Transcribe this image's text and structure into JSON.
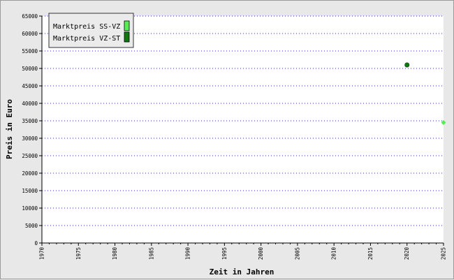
{
  "chart_data": {
    "type": "scatter",
    "xlabel": "Zeit in Jahren",
    "ylabel": "Preis in Euro",
    "xlim": [
      1970,
      2025
    ],
    "ylim": [
      0,
      65000
    ],
    "x_ticks": [
      1970,
      1975,
      1980,
      1985,
      1990,
      1995,
      2000,
      2005,
      2010,
      2015,
      2020,
      2025
    ],
    "y_ticks": [
      0,
      5000,
      10000,
      15000,
      20000,
      25000,
      30000,
      35000,
      40000,
      45000,
      50000,
      55000,
      60000,
      65000
    ],
    "grid": "horizontal-dotted",
    "legend_position": "top-left",
    "series": [
      {
        "name": "Marktpreis SS-VZ",
        "color": "#55ee55",
        "marker": "diamond",
        "points": [
          {
            "x": 2025,
            "y": 34500
          }
        ]
      },
      {
        "name": "Marktpreis VZ-ST",
        "color": "#117711",
        "marker": "circle",
        "points": [
          {
            "x": 2020,
            "y": 51000
          }
        ]
      }
    ]
  }
}
